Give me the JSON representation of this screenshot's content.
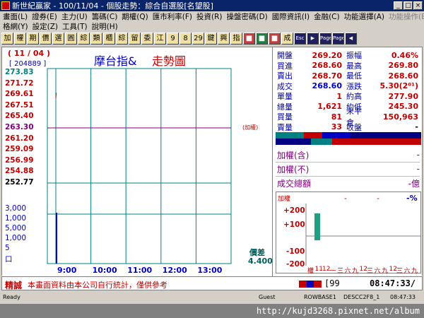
{
  "window": {
    "title": "新世紀贏家 - 100/11/04 - 個股走勢：綜合自選股[名望股]",
    "buttons": [
      "_",
      "□",
      "×"
    ]
  },
  "menu": {
    "row1": [
      {
        "label": "畫面(L)",
        "enabled": true
      },
      {
        "label": "證券(E)",
        "enabled": true
      },
      {
        "label": "主力(U)",
        "enabled": true
      },
      {
        "label": "籌碼(C)",
        "enabled": true
      },
      {
        "label": "期權(Q)",
        "enabled": true
      },
      {
        "label": "匯市利率(F)",
        "enabled": true
      },
      {
        "label": "投資(R)",
        "enabled": true
      },
      {
        "label": "操盤密碼(D)",
        "enabled": true
      },
      {
        "label": "國際資訊(I)",
        "enabled": true
      },
      {
        "label": "金融(C)",
        "enabled": true
      },
      {
        "label": "功能選擇(A)",
        "enabled": true
      },
      {
        "label": "功能操作(B)",
        "enabled": false
      }
    ],
    "row2": [
      {
        "label": "格網(Y)",
        "enabled": true
      },
      {
        "label": "設定(Z)",
        "enabled": true
      },
      {
        "label": "工具(T)",
        "enabled": true
      },
      {
        "label": "說明(H)",
        "enabled": true
      }
    ]
  },
  "toolbar": {
    "buttons": [
      {
        "label": "加",
        "style": "normal"
      },
      {
        "label": "權",
        "style": "normal"
      },
      {
        "label": "期",
        "style": "normal"
      },
      {
        "label": "價",
        "style": "normal"
      },
      {
        "label": "選",
        "style": "normal"
      },
      {
        "label": "圓",
        "style": "normal"
      },
      {
        "label": "綜",
        "style": "normal"
      },
      {
        "label": "類",
        "style": "normal"
      },
      {
        "label": "櫃",
        "style": "normal"
      },
      {
        "label": "綜",
        "style": "normal"
      },
      {
        "label": "留",
        "style": "normal"
      },
      {
        "label": "委",
        "style": "normal"
      },
      {
        "label": "江",
        "style": "normal"
      },
      {
        "label": "9",
        "style": "normal"
      },
      {
        "label": "8",
        "style": "normal"
      },
      {
        "label": "29",
        "style": "normal"
      },
      {
        "label": "鍵",
        "style": "normal"
      },
      {
        "label": "興",
        "style": "normal"
      },
      {
        "label": "指",
        "style": "normal"
      },
      {
        "label": "■",
        "style": "red"
      },
      {
        "label": "■",
        "style": "green"
      },
      {
        "label": "■",
        "style": "red"
      },
      {
        "label": "成",
        "style": "normal"
      },
      {
        "label": "Esc",
        "style": "dark"
      },
      {
        "label": "▶",
        "style": "dark"
      },
      {
        "label": "Page",
        "style": "dark"
      },
      {
        "label": "Page",
        "style": "dark"
      },
      {
        "label": "◀",
        "style": "dark"
      }
    ]
  },
  "chart": {
    "date": "( 11 / 04 )",
    "code": "[ 204889 ]",
    "title_part1": "摩台指&",
    "title_part2": "走勢圖",
    "weighted_tag": "(加權)",
    "jiacha_label": "價差",
    "jiacha_value": "4.400"
  },
  "chart_data": {
    "type": "line",
    "title": "摩台指& 走勢圖",
    "price_ticks": [
      "273.83",
      "271.72",
      "269.61",
      "267.51",
      "265.40",
      "263.30",
      "261.20",
      "259.09",
      "256.99",
      "254.88",
      "252.77"
    ],
    "price_tick_colors": [
      "#008080",
      "#c00000",
      "#c00000",
      "#c00000",
      "#c00000",
      "#800080",
      "#c00000",
      "#c00000",
      "#c00000",
      "#c00000",
      "#000000"
    ],
    "volume_ticks": [
      "3,000",
      "1,000",
      "5,000",
      "1,000",
      "5",
      "口"
    ],
    "time_ticks": [
      "9:00",
      "10:00",
      "11:00",
      "12:00",
      "13:00"
    ],
    "reference_price": 263.3,
    "ylim": [
      252.77,
      273.83
    ],
    "series": [
      {
        "x": [
          "9:00",
          "9:01"
        ],
        "values": [
          269.0,
          270.0
        ]
      }
    ],
    "volume_bars": [
      {
        "x": "9:00",
        "value": 2700
      }
    ]
  },
  "quote": {
    "rows": [
      {
        "l1": "開盤",
        "v1": "269.20",
        "l2": "振幅",
        "v2": "0.46%"
      },
      {
        "l1": "買進",
        "v1": "268.60",
        "l2": "最高",
        "v2": "269.80"
      },
      {
        "l1": "賣出",
        "v1": "268.70",
        "l2": "最低",
        "v2": "268.60"
      },
      {
        "l1": "成交",
        "v1": "268.60",
        "l2": "漲跌",
        "v2": "5.30(2⁰¹)"
      },
      {
        "l1": "單量",
        "v1": "1",
        "l2": "約高",
        "v2": "277.90"
      },
      {
        "l1": "總量",
        "v1": "1,621",
        "l2": "約低",
        "v2": "245.30"
      },
      {
        "l1": "買量",
        "v1": "81",
        "l2": "未平倉",
        "v2": "150,963"
      },
      {
        "l1": "賣量",
        "v1": "33",
        "l2": "收盤",
        "v2": "-"
      }
    ]
  },
  "weighted": {
    "rows": [
      {
        "label": "加權(含)",
        "value": "-"
      },
      {
        "label": "加權(不)",
        "value": "-"
      },
      {
        "label": "成交總額",
        "value": "-億"
      }
    ]
  },
  "delta": {
    "header": "加權",
    "dash1": "-",
    "dash2": "-",
    "pct": "-%",
    "axis": [
      "+200",
      "+100",
      "-100",
      "-200"
    ],
    "xlabels": [
      "權",
      "11",
      "12",
      "一",
      "三",
      "六",
      "九",
      "12",
      "三",
      "六",
      "九",
      "12",
      "三",
      "六",
      "九"
    ]
  },
  "bottom": {
    "brand": "精誠",
    "disclaimer": "本畫面資料由本公司自行統計，僅供參考",
    "counter": "[99",
    "clock": "08:47:33/"
  },
  "status": {
    "left": "Ready",
    "guest": "Guest",
    "server": "ROWBASE1",
    "code": "DESCC2F8_1",
    "time": "08:47:33"
  },
  "watermark": {
    "url": "http://kujd3268.pixnet.net/album"
  }
}
